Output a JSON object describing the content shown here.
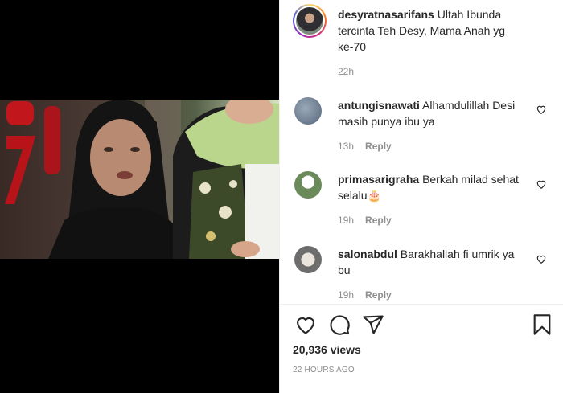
{
  "media": {
    "description_icon": "video-frame"
  },
  "post": {
    "username": "desyratnasarifans",
    "caption": "Ultah Ibunda tercinta Teh Desy, Mama Anah yg ke-70",
    "time": "22h"
  },
  "comments": [
    {
      "username": "antungisnawati",
      "text": "Alhamdulillah Desi masih punya ibu ya",
      "time": "13h",
      "reply": "Reply"
    },
    {
      "username": "primasarigraha",
      "text": "Berkah milad sehat selalu🎂",
      "time": "19h",
      "reply": "Reply"
    },
    {
      "username": "salonabdul",
      "text": "Barakhallah fi umrik ya bu",
      "time": "19h",
      "reply": "Reply"
    }
  ],
  "stats": {
    "views": "20,936 views",
    "posted_ago": "22 HOURS AGO"
  },
  "icons": [
    "heart-icon",
    "comment-icon",
    "share-icon",
    "bookmark-icon"
  ]
}
